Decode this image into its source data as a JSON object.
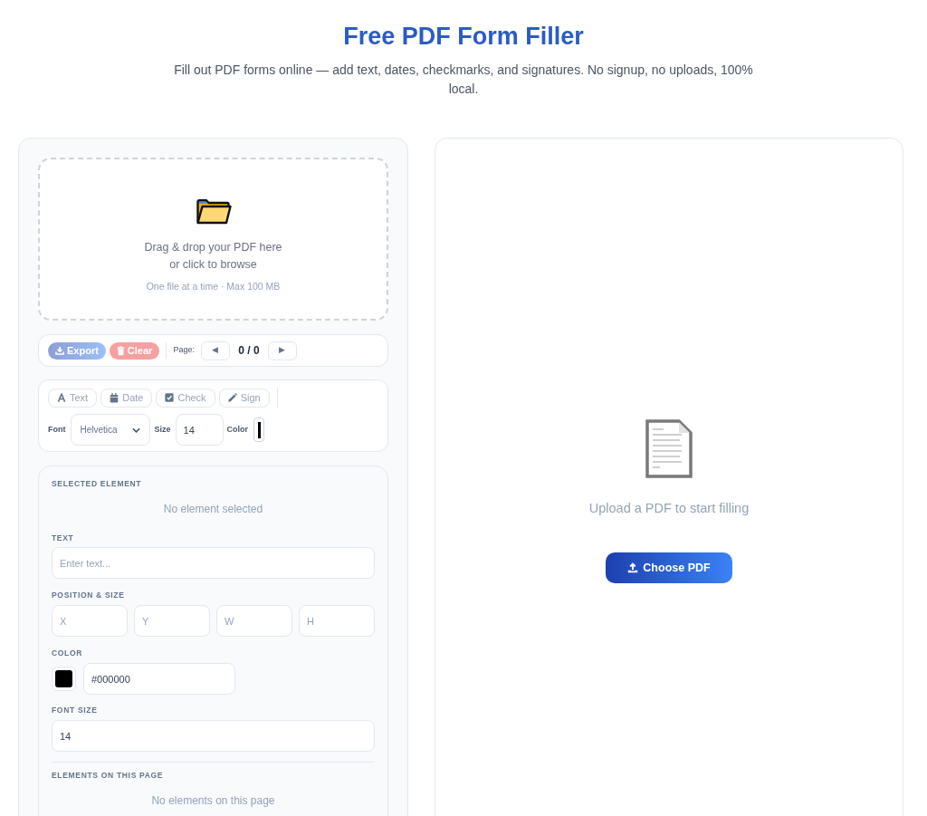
{
  "header": {
    "title": "Free PDF Form Filler",
    "subtitle": "Fill out PDF forms online — add text, dates, checkmarks, and signatures. No signup, no uploads, 100% local."
  },
  "upload_zone": {
    "prompt": "Drag & drop your PDF here",
    "secondary": "or click to browse",
    "hint": "One file at a time · Max 100 MB"
  },
  "actions_bar": {
    "buttons": [
      {
        "kind": "export",
        "label": "Export",
        "disabled": true
      },
      {
        "kind": "clear",
        "label": "Clear",
        "disabled": true
      }
    ],
    "page_label": "Page:",
    "prev_button": "◀",
    "page_counter": "0 / 0",
    "next_button": "▶"
  },
  "tools_bar": {
    "tools": [
      {
        "kind": "text",
        "label": "Text",
        "disabled": true
      },
      {
        "kind": "date",
        "label": "Date",
        "disabled": true
      },
      {
        "kind": "check",
        "label": "Check",
        "disabled": true
      },
      {
        "kind": "sign",
        "label": "Sign",
        "disabled": true
      }
    ],
    "font": {
      "label": "Font",
      "value": "Helvetica"
    },
    "size": {
      "label": "Size",
      "value": "14"
    },
    "color": {
      "label": "Color",
      "color": "#000000"
    }
  },
  "properties": {
    "title": "SELECTED ELEMENT",
    "empty_message": "No element selected",
    "text": {
      "label": "TEXT",
      "placeholder": "Enter text..."
    },
    "position_size": {
      "label": "POSITION & SIZE",
      "fields": [
        {
          "placeholder": "X"
        },
        {
          "placeholder": "Y"
        },
        {
          "placeholder": "W"
        },
        {
          "placeholder": "H"
        }
      ]
    },
    "color": {
      "label": "COLOR",
      "color": "#000000",
      "value": "#000000"
    },
    "font_size": {
      "label": "FONT SIZE",
      "value": "14"
    },
    "elements": {
      "title": "ELEMENTS ON THIS PAGE",
      "empty_message": "No elements on this page"
    }
  },
  "viewer": {
    "empty_message": "Upload a PDF to start filling",
    "button": "Choose PDF"
  }
}
